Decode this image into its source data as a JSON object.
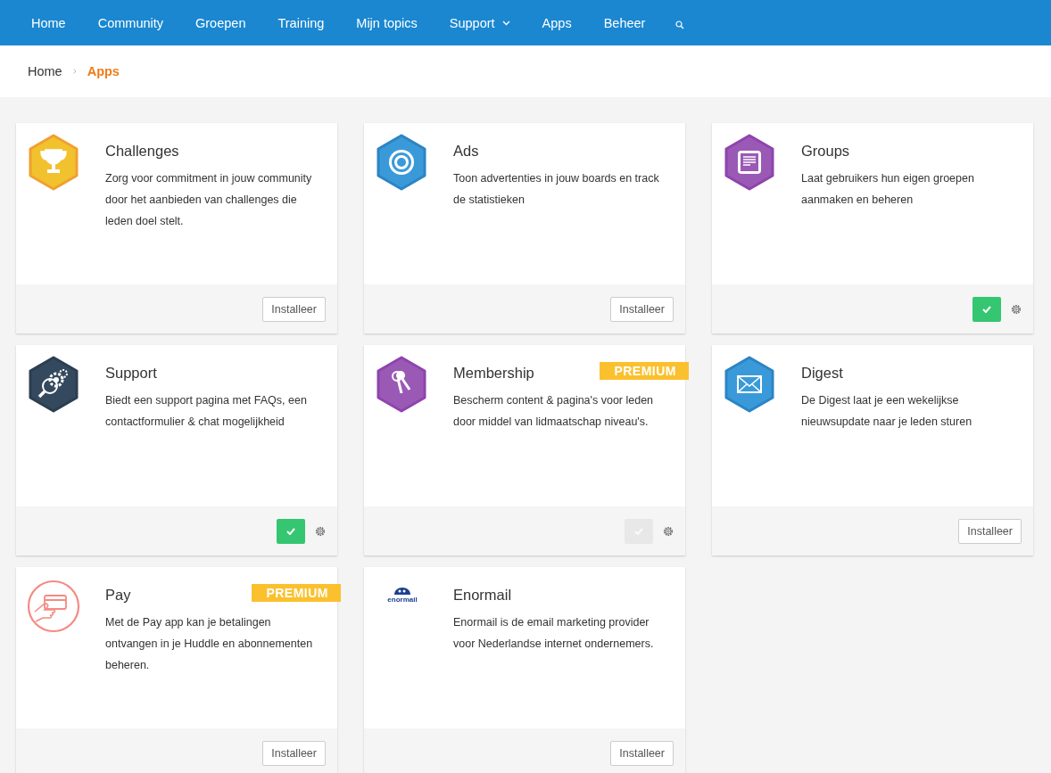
{
  "nav": {
    "items": [
      {
        "label": "Home",
        "dropdown": false
      },
      {
        "label": "Community",
        "dropdown": false
      },
      {
        "label": "Groepen",
        "dropdown": false
      },
      {
        "label": "Training",
        "dropdown": false
      },
      {
        "label": "Mijn topics",
        "dropdown": false
      },
      {
        "label": "Support",
        "dropdown": true
      },
      {
        "label": "Apps",
        "dropdown": false
      },
      {
        "label": "Beheer",
        "dropdown": false
      }
    ]
  },
  "breadcrumb": [
    {
      "label": "Home",
      "selected": false
    },
    {
      "label": "Apps",
      "selected": true
    }
  ],
  "apps": [
    {
      "kind": "trophy",
      "title": "Challenges",
      "description": "Zorg voor commitment in jouw community door het aanbieden van challenges die leden doel stelt.",
      "premium": false,
      "installed": false,
      "button": "Installeer"
    },
    {
      "kind": "target",
      "title": "Ads",
      "description": "Toon advertenties in jouw boards en track de statistieken",
      "premium": false,
      "installed": false,
      "button": "Installeer"
    },
    {
      "kind": "document",
      "title": "Groups",
      "description": "Laat gebruikers hun eigen groepen aanmaken en beheren",
      "premium": false,
      "installed": true,
      "enabled": true
    },
    {
      "kind": "gears",
      "title": "Support",
      "description": "Biedt een support pagina met FAQs, een contactformulier & chat mogelijkheid",
      "premium": false,
      "installed": true,
      "enabled": true
    },
    {
      "kind": "keys",
      "title": "Membership",
      "description": "Bescherm content & pagina's voor leden door middel van lidmaatschap niveau's.",
      "premium": true,
      "premium_label": "PREMIUM",
      "installed": true,
      "enabled": false
    },
    {
      "kind": "envelope",
      "title": "Digest",
      "description": "De Digest laat je een wekelijkse nieuwsupdate naar je leden sturen",
      "premium": false,
      "installed": false,
      "button": "Installeer"
    },
    {
      "kind": "card",
      "title": "Pay",
      "description": "Met de Pay app kan je betalingen ontvangen in je Huddle en abonnementen beheren.",
      "premium": true,
      "premium_label": "PREMIUM",
      "installed": false,
      "button": "Installeer"
    },
    {
      "kind": "logo",
      "logo_text": "enormail",
      "title": "Enormail",
      "description": "Enormail is de email marketing provider voor Nederlandse internet ondernemers.",
      "premium": false,
      "installed": false,
      "button": "Installeer"
    }
  ]
}
